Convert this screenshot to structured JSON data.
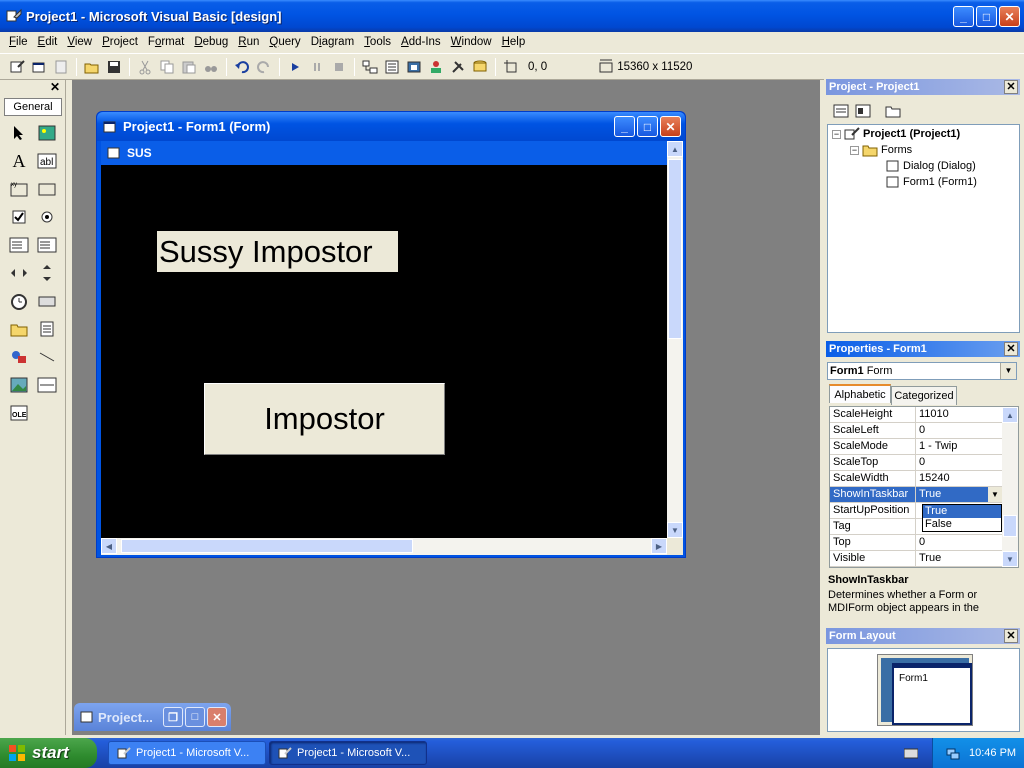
{
  "window": {
    "title": "Project1 - Microsoft Visual Basic [design]",
    "buttons": {
      "minimize": "_",
      "maximize": "□",
      "close": "✕"
    }
  },
  "menu": [
    {
      "label": "File",
      "u": "F",
      "rest": "ile"
    },
    {
      "label": "Edit",
      "u": "E",
      "rest": "dit"
    },
    {
      "label": "View",
      "u": "V",
      "rest": "iew"
    },
    {
      "label": "Project",
      "u": "P",
      "rest": "roject"
    },
    {
      "label": "Format",
      "u": "o",
      "pre": "F",
      "rest": "rmat"
    },
    {
      "label": "Debug",
      "u": "D",
      "rest": "ebug"
    },
    {
      "label": "Run",
      "u": "R",
      "rest": "un"
    },
    {
      "label": "Query",
      "u": "Q",
      "rest": "uery"
    },
    {
      "label": "Diagram",
      "u": "i",
      "pre": "D",
      "rest": "agram"
    },
    {
      "label": "Tools",
      "u": "T",
      "rest": "ools"
    },
    {
      "label": "Add-Ins",
      "u": "A",
      "rest": "dd-Ins"
    },
    {
      "label": "Window",
      "u": "W",
      "rest": "indow"
    },
    {
      "label": "Help",
      "u": "H",
      "rest": "elp"
    }
  ],
  "toolbar": {
    "position": "0, 0",
    "size": "15360 x 11520"
  },
  "toolbox": {
    "tab": "General"
  },
  "form_window": {
    "title": "Project1 - Form1 (Form)",
    "caption": "SUS",
    "label_text": "Sussy Impostor",
    "button_text": "Impostor"
  },
  "minimized": {
    "title": "Project..."
  },
  "project_pane": {
    "title": "Project - Project1",
    "tree": {
      "project": "Project1 (Project1)",
      "folder": "Forms",
      "item1": "Dialog (Dialog)",
      "item2": "Form1 (Form1)"
    }
  },
  "properties_pane": {
    "title": "Properties - Form1",
    "object_name": "Form1",
    "object_type": "Form",
    "tabs": {
      "alphabetic": "Alphabetic",
      "categorized": "Categorized"
    },
    "rows": [
      {
        "name": "ScaleHeight",
        "value": "11010"
      },
      {
        "name": "ScaleLeft",
        "value": "0"
      },
      {
        "name": "ScaleMode",
        "value": "1 - Twip"
      },
      {
        "name": "ScaleTop",
        "value": "0"
      },
      {
        "name": "ScaleWidth",
        "value": "15240"
      },
      {
        "name": "ShowInTaskbar",
        "value": "True"
      },
      {
        "name": "StartUpPosition",
        "value": ""
      },
      {
        "name": "Tag",
        "value": ""
      },
      {
        "name": "Top",
        "value": "0"
      },
      {
        "name": "Visible",
        "value": "True"
      }
    ],
    "dropdown_options": [
      "True",
      "False"
    ],
    "description_title": "ShowInTaskbar",
    "description_text": "Determines whether a Form or MDIForm object appears in the"
  },
  "layout_pane": {
    "title": "Form Layout",
    "form_label": "Form1"
  },
  "taskbar": {
    "start": "start",
    "task1": "Project1 - Microsoft V...",
    "task2": "Project1 - Microsoft V...",
    "clock": "10:46 PM"
  },
  "colors": {
    "xp_blue": "#0054e3",
    "canvas": "#000000",
    "start_green": "#2e8b2e"
  }
}
